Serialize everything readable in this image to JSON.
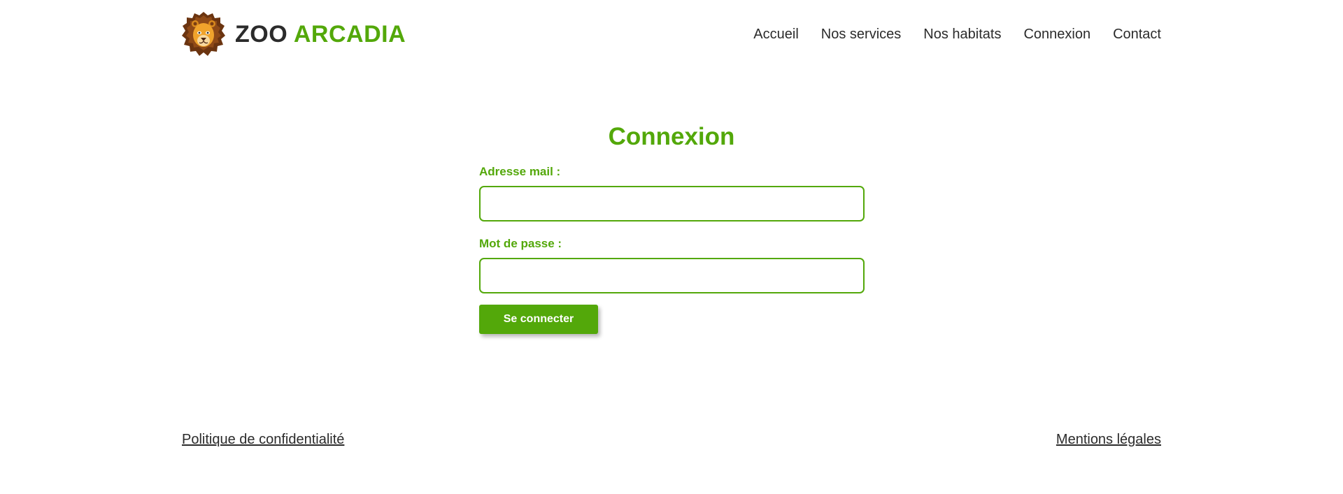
{
  "header": {
    "logo_icon": "lion-head-icon",
    "brand_first": "ZOO",
    "brand_second": "ARCADIA",
    "nav": [
      {
        "label": "Accueil"
      },
      {
        "label": "Nos services"
      },
      {
        "label": "Nos habitats"
      },
      {
        "label": "Connexion"
      },
      {
        "label": "Contact"
      }
    ]
  },
  "main": {
    "title": "Connexion",
    "email_label": "Adresse mail :",
    "email_value": "",
    "password_label": "Mot de passe :",
    "password_value": "",
    "submit_label": "Se connecter"
  },
  "footer": {
    "privacy_label": "Politique de confidentialité",
    "legal_label": "Mentions légales"
  },
  "colors": {
    "accent": "#53a80a",
    "text": "#2b2b2b",
    "background": "#ffffff"
  }
}
